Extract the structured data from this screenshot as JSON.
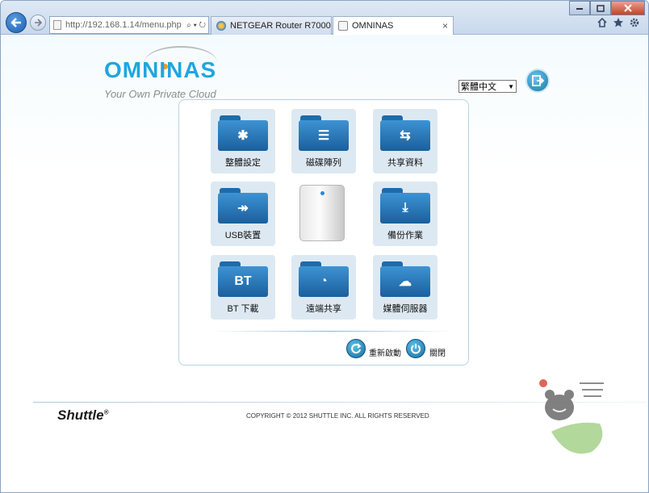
{
  "browser": {
    "address_url": "http://192.168.1.14/menu.php",
    "address_tools": "⌕ ▾ ↻",
    "tabs": [
      {
        "label": "NETGEAR Router R7000",
        "active": false
      },
      {
        "label": "OMNINAS",
        "active": true,
        "close": "×"
      }
    ],
    "right_icons": [
      "home-icon",
      "star-icon",
      "gear-icon"
    ]
  },
  "header": {
    "logo_title": "OMNINAS",
    "logo_subtitle": "Your Own Private Cloud",
    "language_value": "繁體中文"
  },
  "menu": {
    "items": [
      {
        "label": "整體設定",
        "icon": "tools-icon",
        "glyph": "✱"
      },
      {
        "label": "磁碟陣列",
        "icon": "disk-array-icon",
        "glyph": "☰"
      },
      {
        "label": "共享資料",
        "icon": "share-icon",
        "glyph": "⇆"
      },
      {
        "label": "USB裝置",
        "icon": "usb-icon",
        "glyph": "↠"
      },
      {
        "label": "備份作業",
        "icon": "backup-icon",
        "glyph": "⤓"
      },
      {
        "label": "BT 下載",
        "icon": "bt-icon",
        "glyph": "BT"
      },
      {
        "label": "遠端共享",
        "icon": "remote-share-icon",
        "glyph": "◔"
      },
      {
        "label": "媒體伺服器",
        "icon": "media-server-icon",
        "glyph": "☁"
      }
    ]
  },
  "actions": {
    "restart_label": "重新啟動",
    "shutdown_label": "關閉"
  },
  "footer": {
    "brand": "Shuttle",
    "brand_mark": "®",
    "copyright": "COPYRIGHT © 2012 SHUTTLE INC. ALL RIGHTS RESERVED"
  },
  "colors": {
    "accent": "#1fa6e0",
    "folder": "#2a7cc0",
    "tile_bg": "#dde9f2"
  }
}
